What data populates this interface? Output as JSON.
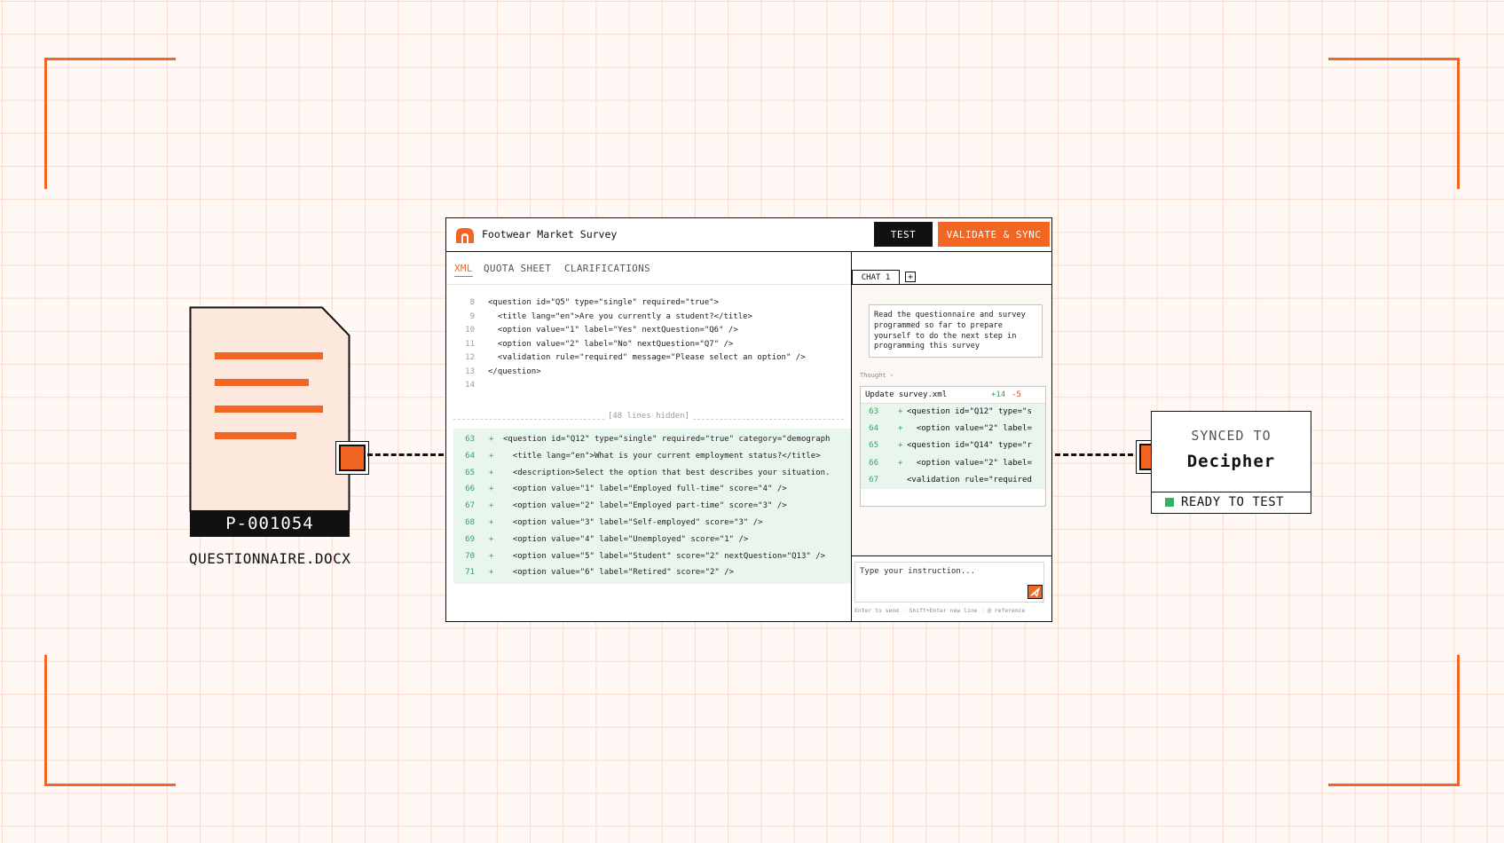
{
  "document": {
    "id": "P-001054",
    "filename": "QUESTIONNAIRE.DOCX"
  },
  "app": {
    "title": "Footwear Market Survey",
    "buttons": {
      "test": "TEST",
      "validate_sync": "VALIDATE & SYNC"
    },
    "tabs": [
      "XML",
      "QUOTA SHEET",
      "CLARIFICATIONS"
    ],
    "code_lines": [
      {
        "n": "8",
        "text": "<question id=\"Q5\" type=\"single\" required=\"true\">"
      },
      {
        "n": "9",
        "text": "  <title lang=\"en\">Are you currently a student?</title>"
      },
      {
        "n": "10",
        "text": "  <option value=\"1\" label=\"Yes\" nextQuestion=\"Q6\" />"
      },
      {
        "n": "11",
        "text": "  <option value=\"2\" label=\"No\" nextQuestion=\"Q7\" />"
      },
      {
        "n": "12",
        "text": "  <validation rule=\"required\" message=\"Please select an option\" />"
      },
      {
        "n": "13",
        "text": "</question>"
      },
      {
        "n": "14",
        "text": ""
      }
    ],
    "hidden_lines": "[48 lines hidden]",
    "diff_lines": [
      {
        "n": "63",
        "sign": "+",
        "text": "<question id=\"Q12\" type=\"single\" required=\"true\" category=\"demograph"
      },
      {
        "n": "64",
        "sign": "+",
        "text": "  <title lang=\"en\">What is your current employment status?</title>"
      },
      {
        "n": "65",
        "sign": "+",
        "text": "  <description>Select the option that best describes your situation."
      },
      {
        "n": "66",
        "sign": "+",
        "text": "  <option value=\"1\" label=\"Employed full-time\" score=\"4\" />"
      },
      {
        "n": "67",
        "sign": "+",
        "text": "  <option value=\"2\" label=\"Employed part-time\" score=\"3\" />"
      },
      {
        "n": "68",
        "sign": "+",
        "text": "  <option value=\"3\" label=\"Self-employed\" score=\"3\" />"
      },
      {
        "n": "69",
        "sign": "+",
        "text": "  <option value=\"4\" label=\"Unemployed\" score=\"1\" />"
      },
      {
        "n": "70",
        "sign": "+",
        "text": "  <option value=\"5\" label=\"Student\" score=\"2\" nextQuestion=\"Q13\" />"
      },
      {
        "n": "71",
        "sign": "+",
        "text": "  <option value=\"6\" label=\"Retired\" score=\"2\" />"
      }
    ]
  },
  "chat": {
    "tab_label": "CHAT 1",
    "add_label": "+",
    "message": "Read the questionnaire and survey programmed so far to prepare yourself to do the next step in programming this survey",
    "thought_label": "Thought ›",
    "update": {
      "file": "Update survey.xml",
      "added": "+14",
      "removed": "-5",
      "lines": [
        {
          "n": "63",
          "sign": "+",
          "text": "<question id=\"Q12\" type=\"s"
        },
        {
          "n": "64",
          "sign": "+",
          "text": "  <option value=\"2\" label="
        },
        {
          "n": "65",
          "sign": "+",
          "text": "<question id=\"Q14\" type=\"r"
        },
        {
          "n": "66",
          "sign": "+",
          "text": "  <option value=\"2\" label="
        },
        {
          "n": "67",
          "sign": "",
          "text": "<validation rule=\"required"
        }
      ]
    },
    "input_placeholder": "Type your instruction...",
    "hint": "Enter to send · Shift+Enter new line · @ reference"
  },
  "target": {
    "synced_to": "SYNCED TO",
    "name": "Decipher",
    "status": "READY TO TEST",
    "status_color": "#2fb462"
  },
  "colors": {
    "accent": "#f26522",
    "ink": "#111111",
    "diff_bg": "#e9f6ee",
    "grid": "#f8dccd"
  },
  "icons": [
    "document-icon",
    "connector-node-icon",
    "app-logo-icon",
    "send-icon",
    "status-dot-icon"
  ]
}
